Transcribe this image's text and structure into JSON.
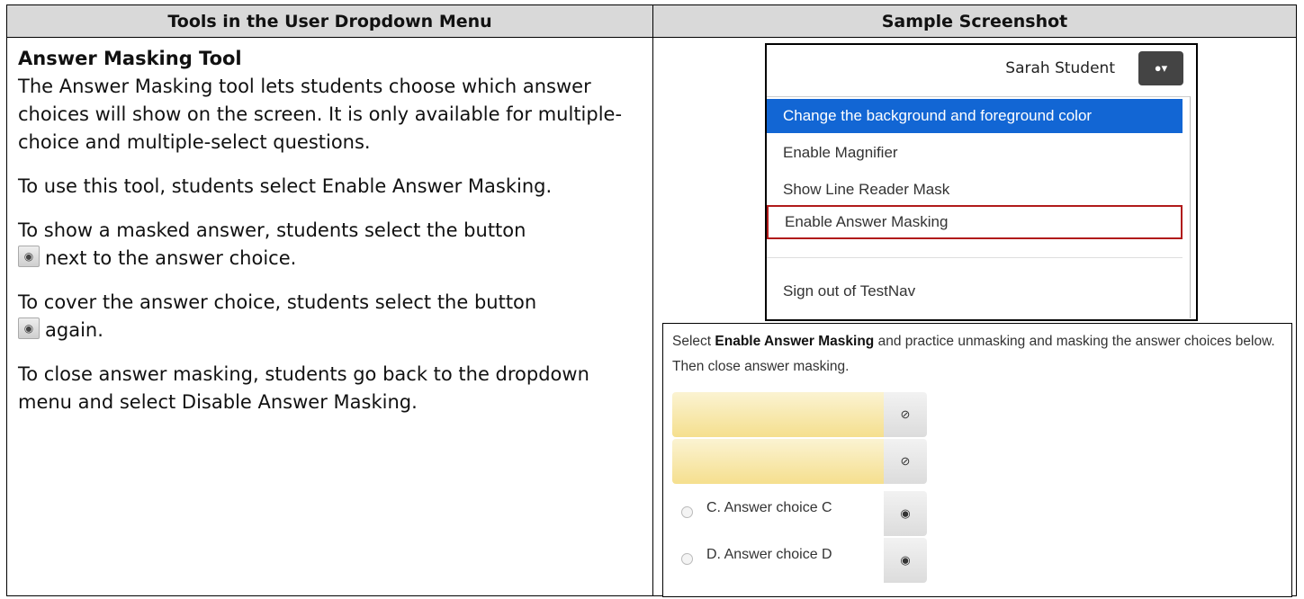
{
  "table": {
    "header_left": "Tools in the User Dropdown Menu",
    "header_right": "Sample Screenshot"
  },
  "left": {
    "heading": "Answer Masking Tool",
    "intro": "The Answer Masking tool lets students choose which answer choices will show on the screen. It is only available for multiple-choice and multiple-select questions.",
    "step_enable": "To use this tool, students select Enable Answer Masking.",
    "step_show_a": "To show a masked answer, students select the button",
    "step_show_b": "next to the answer choice.",
    "step_cover_a": "To cover the answer choice, students select the button",
    "step_cover_b": "again.",
    "step_close": "To close answer masking, students go back to the dropdown menu and select Disable Answer Masking.",
    "inline_icons": [
      "eye-slash-button-icon",
      "eye-button-icon"
    ]
  },
  "dropdown_shot": {
    "user_name": "Sarah Student",
    "user_icon": "user-icon",
    "menu_items": [
      "Change the background and foreground color",
      "Enable Magnifier",
      "Show Line Reader Mask",
      "Enable Answer Masking",
      "Sign out of TestNav"
    ],
    "active_item": "Change the background and foreground color",
    "highlighted_item": "Enable Answer Masking",
    "colors": {
      "active": "#1266d4",
      "highlight_border": "#b11a1a",
      "user_button": "#444444"
    }
  },
  "practice_shot": {
    "instruction_pre": "Select ",
    "instruction_bold": "Enable Answer Masking",
    "instruction_post": " and practice unmasking and masking the answer choices below. Then close answer masking.",
    "answers": [
      {
        "masked": true,
        "toggle_icon": "eye-slash-icon"
      },
      {
        "masked": true,
        "toggle_icon": "eye-slash-icon"
      },
      {
        "masked": false,
        "label": "C.  Answer choice C",
        "toggle_icon": "eye-icon"
      },
      {
        "masked": false,
        "label": "D.  Answer choice D",
        "toggle_icon": "eye-icon"
      }
    ],
    "colors": {
      "mask": "#f5df8e"
    }
  }
}
